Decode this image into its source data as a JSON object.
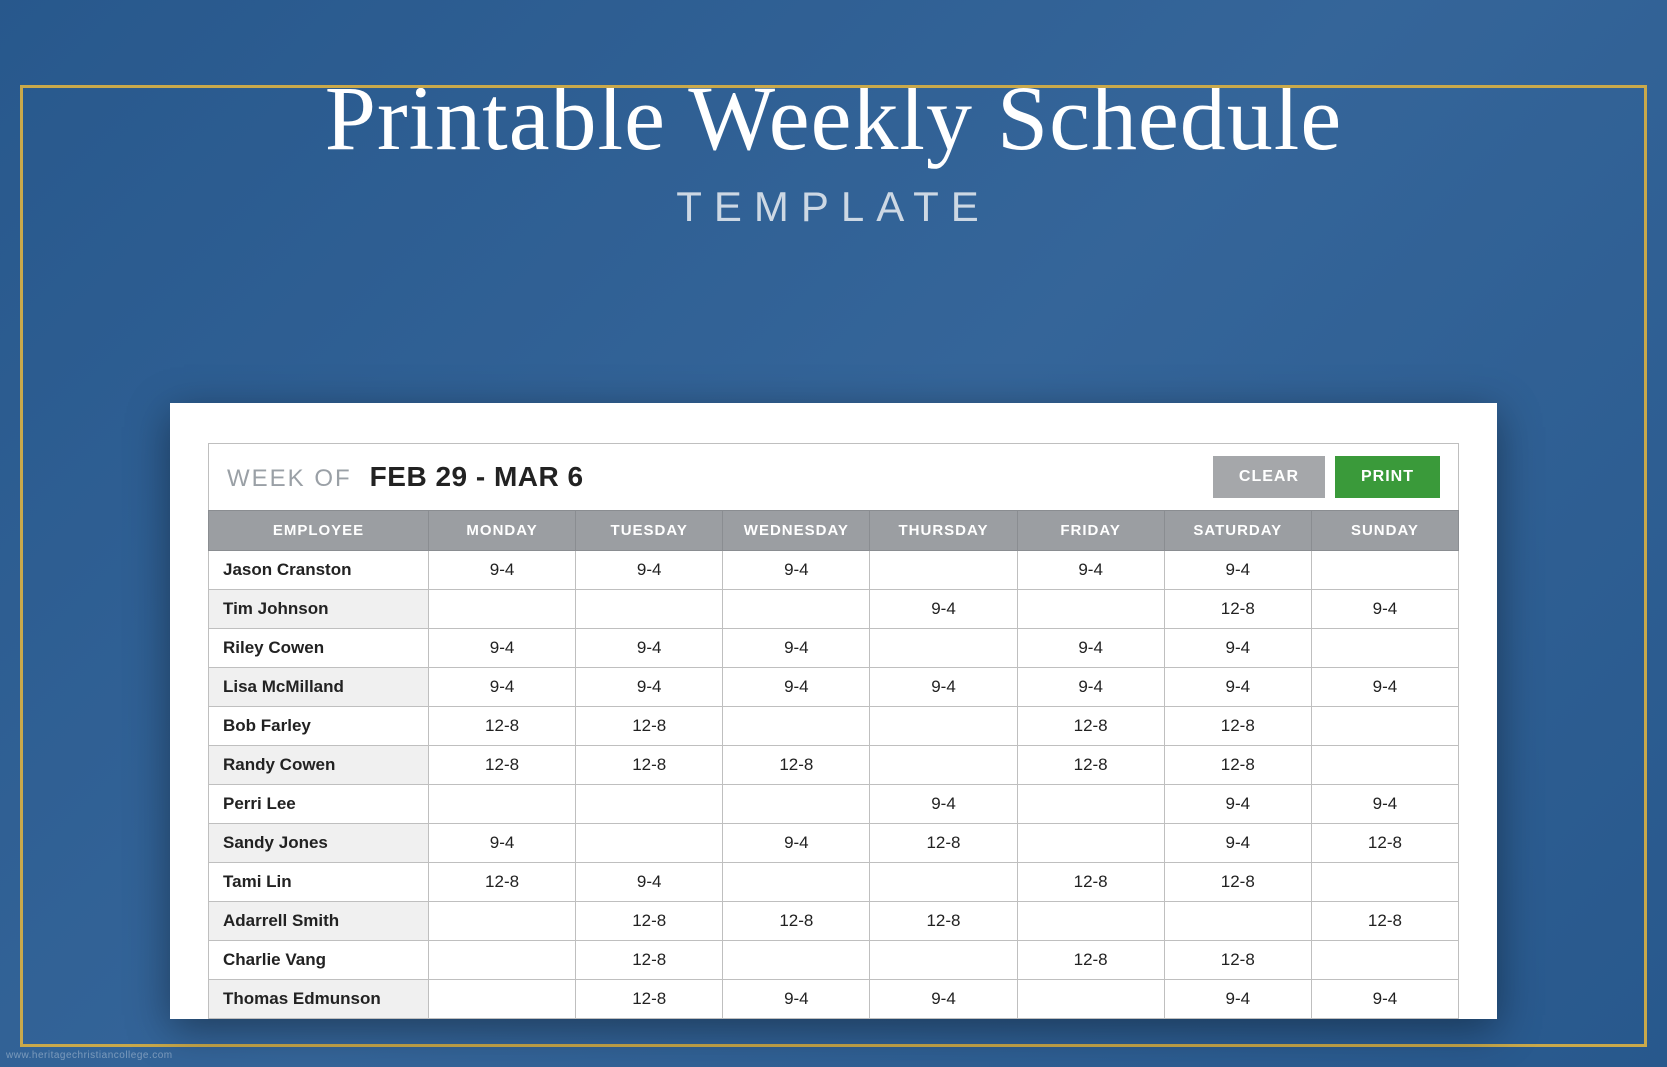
{
  "title": "Printable Weekly Schedule",
  "subtitle": "TEMPLATE",
  "week_of_label": "WEEK OF",
  "week_of_value": "FEB 29 - MAR 6",
  "buttons": {
    "clear": "CLEAR",
    "print": "PRINT"
  },
  "columns": [
    "EMPLOYEE",
    "MONDAY",
    "TUESDAY",
    "WEDNESDAY",
    "THURSDAY",
    "FRIDAY",
    "SATURDAY",
    "SUNDAY"
  ],
  "rows": [
    {
      "employee": "Jason Cranston",
      "days": [
        "9-4",
        "9-4",
        "9-4",
        "",
        "9-4",
        "9-4",
        ""
      ]
    },
    {
      "employee": "Tim Johnson",
      "days": [
        "",
        "",
        "",
        "9-4",
        "",
        "12-8",
        "9-4"
      ]
    },
    {
      "employee": "Riley Cowen",
      "days": [
        "9-4",
        "9-4",
        "9-4",
        "",
        "9-4",
        "9-4",
        ""
      ]
    },
    {
      "employee": "Lisa McMilland",
      "days": [
        "9-4",
        "9-4",
        "9-4",
        "9-4",
        "9-4",
        "9-4",
        "9-4"
      ]
    },
    {
      "employee": "Bob Farley",
      "days": [
        "12-8",
        "12-8",
        "",
        "",
        "12-8",
        "12-8",
        ""
      ]
    },
    {
      "employee": "Randy Cowen",
      "days": [
        "12-8",
        "12-8",
        "12-8",
        "",
        "12-8",
        "12-8",
        ""
      ]
    },
    {
      "employee": "Perri Lee",
      "days": [
        "",
        "",
        "",
        "9-4",
        "",
        "9-4",
        "9-4"
      ]
    },
    {
      "employee": "Sandy Jones",
      "days": [
        "9-4",
        "",
        "9-4",
        "12-8",
        "",
        "9-4",
        "12-8"
      ]
    },
    {
      "employee": "Tami Lin",
      "days": [
        "12-8",
        "9-4",
        "",
        "",
        "12-8",
        "12-8",
        ""
      ]
    },
    {
      "employee": "Adarrell Smith",
      "days": [
        "",
        "12-8",
        "12-8",
        "12-8",
        "",
        "",
        "12-8"
      ]
    },
    {
      "employee": "Charlie Vang",
      "days": [
        "",
        "12-8",
        "",
        "",
        "12-8",
        "12-8",
        ""
      ]
    },
    {
      "employee": "Thomas Edmunson",
      "days": [
        "",
        "12-8",
        "9-4",
        "9-4",
        "",
        "9-4",
        "9-4"
      ]
    }
  ],
  "watermark": "www.heritagechristiancollege.com"
}
